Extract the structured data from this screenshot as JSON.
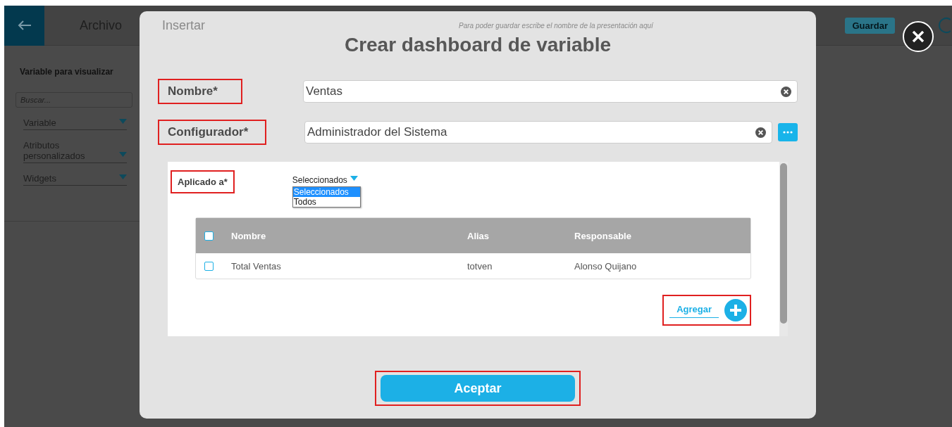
{
  "topbar": {
    "file_menu": "Archivo",
    "insert_menu": "Insertar",
    "name_placeholder": "Para poder guardar escribe el nombre de la presentación aquí",
    "save": "Guardar"
  },
  "sidebar": {
    "title": "Variable para visualizar",
    "search_placeholder": "Buscar...",
    "sections": [
      {
        "label": "Variable"
      },
      {
        "label": "Atributos personalizados"
      },
      {
        "label": "Widgets"
      }
    ]
  },
  "dialog": {
    "title": "Crear dashboard de variable",
    "fields": [
      {
        "label": "Nombre*",
        "value": "Ventas",
        "kind": "text"
      },
      {
        "label": "Configurador*",
        "value": "Administrador del Sistema",
        "kind": "picker"
      }
    ],
    "applied": {
      "label": "Aplicado a*",
      "value": "Seleccionados",
      "options": [
        {
          "label": "Seleccionados",
          "selected": true
        },
        {
          "label": "Todos",
          "selected": false
        }
      ]
    },
    "table": {
      "all_checked": false,
      "columns": [
        "Nombre",
        "Alias",
        "Responsable"
      ],
      "rows": [
        {
          "checked": false,
          "cells": [
            "Total Ventas",
            "totven",
            "Alonso Quijano"
          ]
        }
      ]
    },
    "add": "Agregar",
    "accept": "Aceptar"
  }
}
